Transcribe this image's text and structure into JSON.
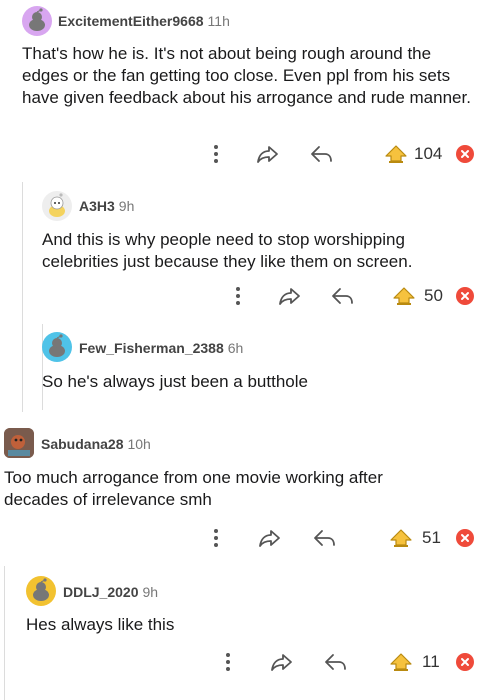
{
  "comments": [
    {
      "username": "ExcitementEither9668",
      "time": "11h",
      "text": "That's how he is. It's not about being rough around the edges or the fan getting too close. Even ppl from his sets have given feedback about his arrogance and rude manner.",
      "votes": "104",
      "avatar_color": "#d8a6f0"
    },
    {
      "username": "A3H3",
      "time": "9h",
      "text": "And this is why people need to stop worshipping celebrities just because they like them on screen.",
      "votes": "50",
      "avatar_color": "#eeeeee"
    },
    {
      "username": "Few_Fisherman_2388",
      "time": "6h",
      "text": "So he's always just been a butthole"
    },
    {
      "username": "Sabudana28",
      "time": "10h",
      "text": "Too much arrogance from one movie working after decades of irrelevance smh",
      "votes": "51"
    },
    {
      "username": "DDLJ_2020",
      "time": "9h",
      "text": "Hes always like this",
      "votes": "11"
    }
  ],
  "icons": [
    "more-icon",
    "share-icon",
    "reply-icon",
    "award-icon",
    "close-icon"
  ],
  "colors": {
    "award_gold": "#f6c23e",
    "close_red": "#ef4a3a",
    "thread_line": "#dcdcdc"
  }
}
